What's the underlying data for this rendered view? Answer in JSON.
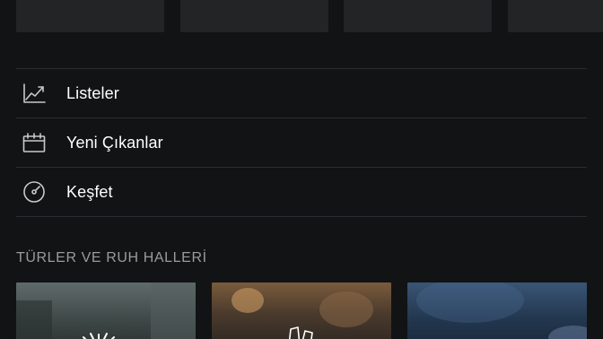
{
  "nav": {
    "items": [
      {
        "label": "Listeler",
        "icon": "chart-line-icon"
      },
      {
        "label": "Yeni Çıkanlar",
        "icon": "calendar-icon"
      },
      {
        "label": "Keşfet",
        "icon": "compass-icon"
      }
    ]
  },
  "sections": {
    "genres_title": "TÜRLER VE RUH HALLERİ"
  },
  "colors": {
    "background": "#121314",
    "tile": "#222426",
    "separator": "#2b2d30",
    "text": "#ffffff",
    "muted_text": "#9a9b9d"
  }
}
